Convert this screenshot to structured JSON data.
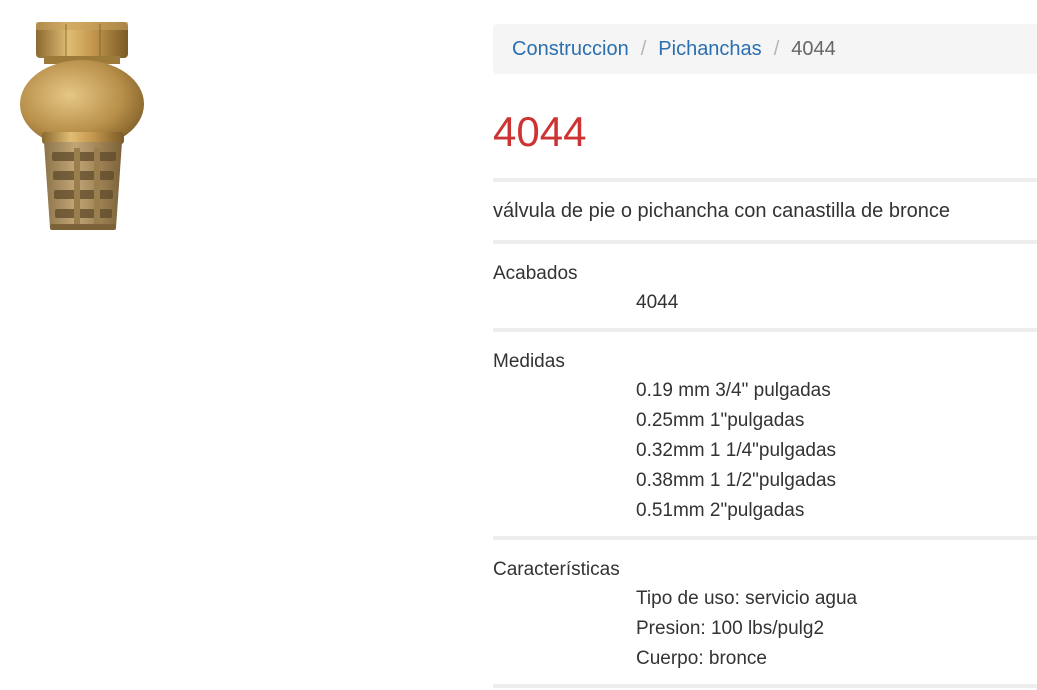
{
  "product_image": {
    "alt": "válvula de pie o pichancha con canastilla de bronce",
    "colors": {
      "brass_light": "#d9b36a",
      "brass_mid": "#b08a45",
      "brass_dark": "#7a5a26",
      "strainer": "#9a7e4e"
    }
  },
  "breadcrumb": {
    "items": [
      {
        "label": "Construccion"
      },
      {
        "label": "Pichanchas"
      },
      {
        "label": "4044"
      }
    ],
    "separator": "/"
  },
  "product": {
    "title": "4044",
    "description": "válvula de pie o pichancha con canastilla de bronce"
  },
  "sections": {
    "acabados": {
      "label": "Acabados",
      "values": [
        "4044"
      ]
    },
    "medidas": {
      "label": "Medidas",
      "values": [
        "0.19 mm 3/4\" pulgadas",
        "0.25mm 1\"pulgadas",
        "0.32mm 1 1/4\"pulgadas",
        "0.38mm 1 1/2\"pulgadas",
        "0.51mm 2\"pulgadas"
      ]
    },
    "caracteristicas": {
      "label": "Características",
      "values": [
        "Tipo de uso: servicio agua",
        "Presion: 100 lbs/pulg2",
        "Cuerpo: bronce"
      ]
    }
  },
  "theme": {
    "link_color": "#2a6fb0",
    "title_color": "#cc3333",
    "text_color": "#333333",
    "divider_color": "#eeeeee",
    "breadcrumb_bg": "#f5f5f5"
  }
}
